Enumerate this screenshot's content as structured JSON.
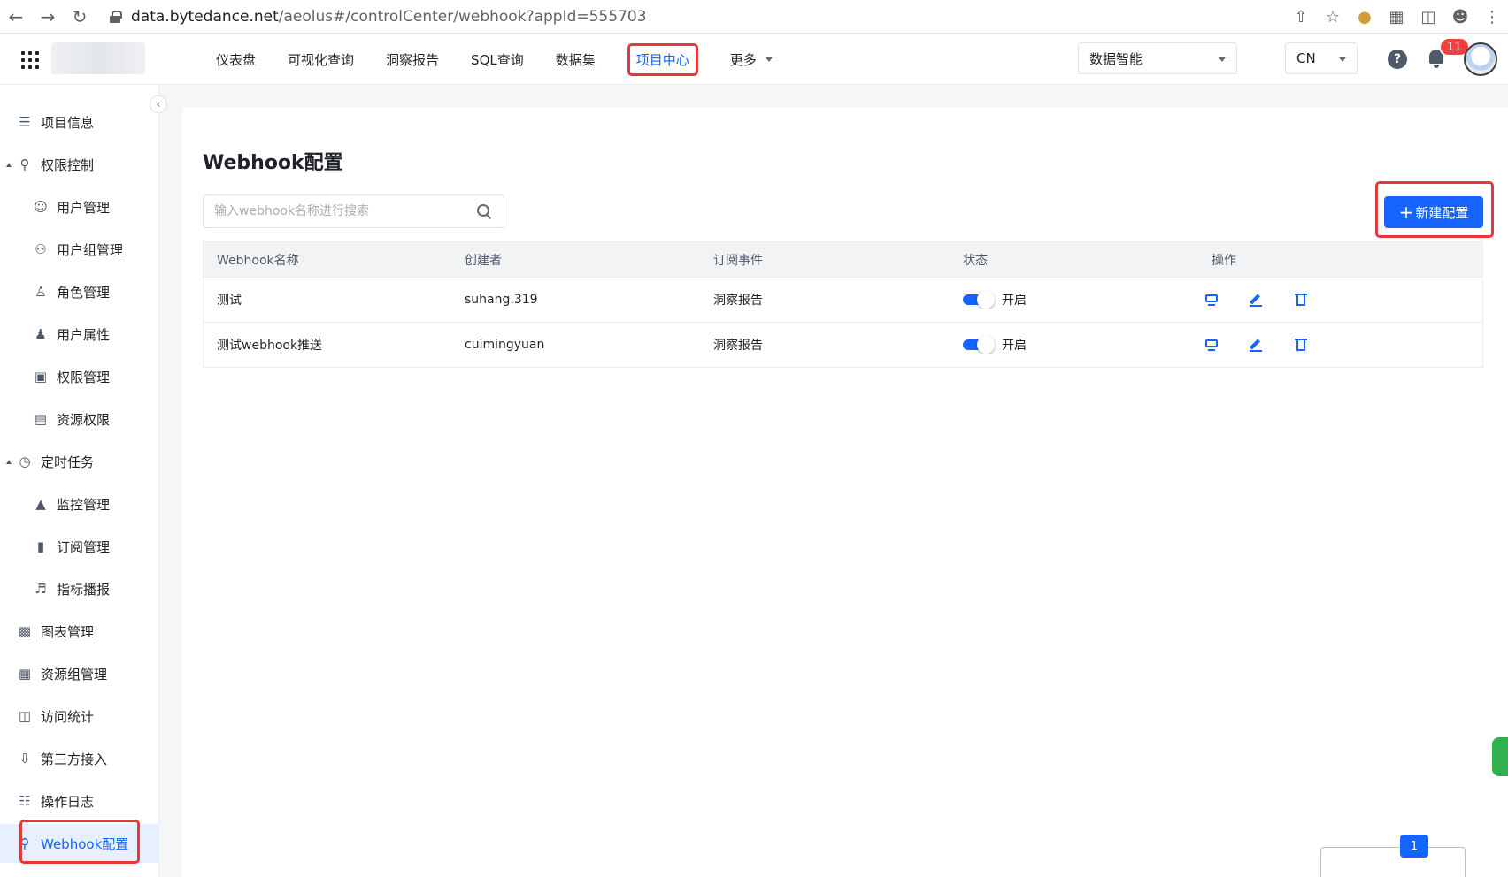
{
  "browser": {
    "url_host": "data.bytedance.net",
    "url_path": "/aeolus#/controlCenter/webhook?appId=555703"
  },
  "header": {
    "nav": [
      {
        "label": "仪表盘"
      },
      {
        "label": "可视化查询"
      },
      {
        "label": "洞察报告"
      },
      {
        "label": "SQL查询"
      },
      {
        "label": "数据集"
      },
      {
        "label": "项目中心",
        "active": true
      },
      {
        "label": "更多"
      }
    ],
    "org_select": "数据智能",
    "lang_select": "CN",
    "notification_count": "11"
  },
  "sidebar": {
    "items": [
      {
        "label": "项目信息",
        "icon": "list-icon"
      },
      {
        "label": "权限控制",
        "icon": "shield-icon"
      },
      {
        "label": "用户管理",
        "icon": "user-icon"
      },
      {
        "label": "用户组管理",
        "icon": "users-icon"
      },
      {
        "label": "角色管理",
        "icon": "role-icon"
      },
      {
        "label": "用户属性",
        "icon": "user-attr-icon"
      },
      {
        "label": "权限管理",
        "icon": "lock-icon"
      },
      {
        "label": "资源权限",
        "icon": "resource-icon"
      },
      {
        "label": "定时任务",
        "icon": "clock-icon"
      },
      {
        "label": "监控管理",
        "icon": "monitor-icon"
      },
      {
        "label": "订阅管理",
        "icon": "bookmark-icon"
      },
      {
        "label": "指标播报",
        "icon": "speaker-icon"
      },
      {
        "label": "图表管理",
        "icon": "bar-chart-icon"
      },
      {
        "label": "资源组管理",
        "icon": "server-icon"
      },
      {
        "label": "访问统计",
        "icon": "stats-icon"
      },
      {
        "label": "第三方接入",
        "icon": "plug-icon"
      },
      {
        "label": "操作日志",
        "icon": "log-icon"
      },
      {
        "label": "Webhook配置",
        "icon": "webhook-icon",
        "active": true
      }
    ]
  },
  "main": {
    "title": "Webhook配置",
    "search_placeholder": "输入webhook名称进行搜索",
    "new_button": "新建配置",
    "columns": [
      "Webhook名称",
      "创建者",
      "订阅事件",
      "状态",
      "操作"
    ],
    "rows": [
      {
        "name": "测试",
        "creator": "suhang.319",
        "event": "洞察报告",
        "status": "开启",
        "enabled": true
      },
      {
        "name": "测试webhook推送",
        "creator": "cuimingyuan",
        "event": "洞察报告",
        "status": "开启",
        "enabled": true
      }
    ],
    "current_page": "1"
  }
}
